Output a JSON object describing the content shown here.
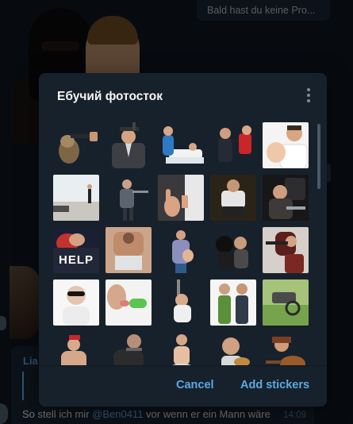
{
  "background_chat": {
    "top_message_preview": "Bald hast du keine Pro...",
    "bottom_message": {
      "sender": "Lia",
      "text_before": "So stell ich mir ",
      "mention": "@Ben0411",
      "text_after": " vor wenn er ein Mann wäre",
      "time": "14:09"
    }
  },
  "dialog": {
    "title": "Ебучий фотосток",
    "menu_icon": "more-vertical-icon",
    "buttons": {
      "cancel": "Cancel",
      "add": "Add stickers"
    },
    "scroll_position": 0.0,
    "sticker_rows": [
      [
        "dog-with-gun",
        "man-in-suit-with-gun",
        "nurse-with-patient",
        "man-with-gun-and-woman",
        "man-holding-baby"
      ],
      [
        "man-walking-beach",
        "man-with-hammer",
        "hand-taking-money",
        "man-on-couch",
        "woman-at-laptop"
      ],
      [
        "help-text",
        "man-at-laptop",
        "pregnant-woman",
        "masked-robber",
        "woman-pointing-gun"
      ],
      [
        "old-woman-sunglasses",
        "tongue-cactus",
        "scale-woman",
        "couple-talking",
        "wheelchair-on-grass"
      ],
      [
        "woman-in-bathtub",
        "man-with-mask",
        "woman-on-knee",
        "man-eating-burger",
        "woman-with-guitar"
      ]
    ],
    "help_caption": "HELP"
  },
  "colors": {
    "modal_bg": "#17212b",
    "accent": "#5aa9e6",
    "title": "#f5f5f5",
    "chat_bg": "#0e1621"
  }
}
